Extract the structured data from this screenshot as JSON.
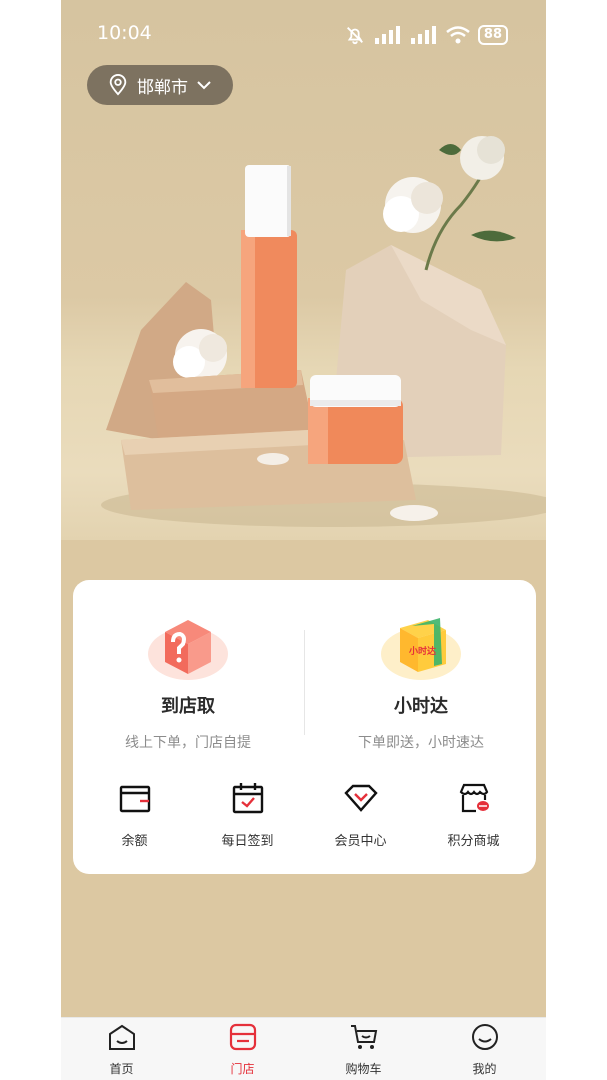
{
  "status_bar": {
    "time": "10:04",
    "battery": "88"
  },
  "location": {
    "city": "邯郸市"
  },
  "services": [
    {
      "title": "到店取",
      "desc": "线上下单，门店自提"
    },
    {
      "title": "小时达",
      "desc": "下单即送，小时速达",
      "badge": "小时达"
    }
  ],
  "quick_actions": [
    {
      "label": "余额",
      "icon": "wallet-icon"
    },
    {
      "label": "每日签到",
      "icon": "calendar-check-icon"
    },
    {
      "label": "会员中心",
      "icon": "diamond-icon"
    },
    {
      "label": "积分商城",
      "icon": "store-coin-icon"
    }
  ],
  "tabs": [
    {
      "label": "首页",
      "icon": "home-icon"
    },
    {
      "label": "门店",
      "icon": "store-icon",
      "active": true
    },
    {
      "label": "购物车",
      "icon": "cart-icon"
    },
    {
      "label": "我的",
      "icon": "smile-icon"
    }
  ],
  "colors": {
    "accent": "#e5303a",
    "orange": "#f08a5d",
    "card_bg": "#ffffff",
    "page_bg": "#dcc8a2"
  }
}
